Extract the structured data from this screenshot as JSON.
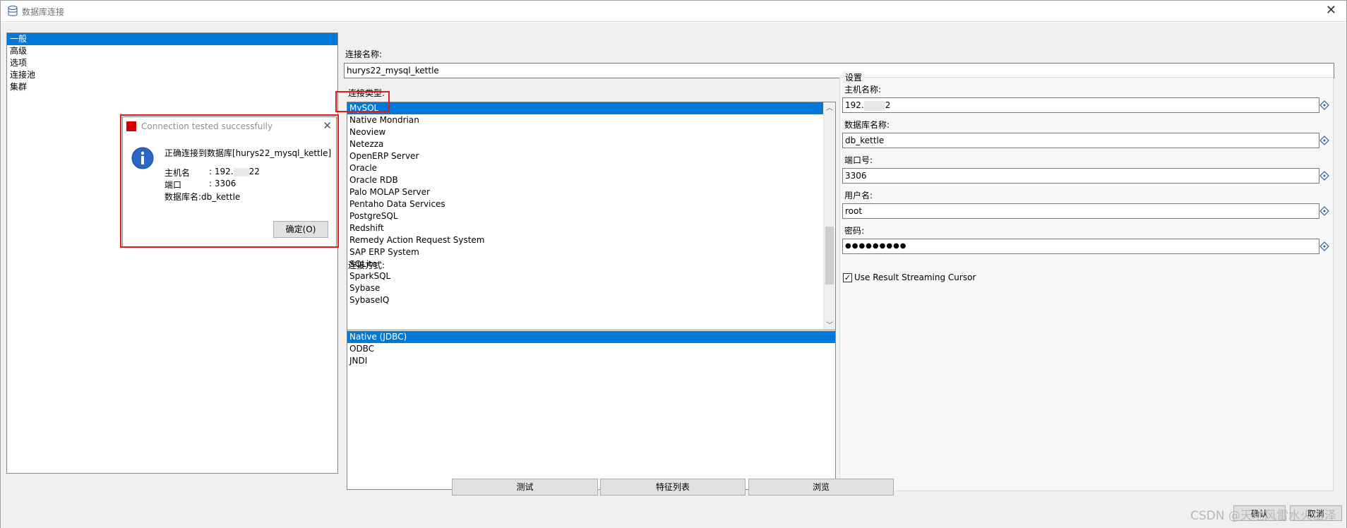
{
  "window": {
    "title": "数据库连接",
    "close_glyph": "✕"
  },
  "nav": {
    "items": [
      {
        "label": "一般",
        "selected": true
      },
      {
        "label": "高级",
        "selected": false
      },
      {
        "label": "选项",
        "selected": false
      },
      {
        "label": "连接池",
        "selected": false
      },
      {
        "label": "集群",
        "selected": false
      }
    ]
  },
  "form": {
    "connection_name_label": "连接名称:",
    "connection_name_value": "hurys22_mysql_kettle",
    "connection_type_label": "连接类型:",
    "connection_types": [
      "MySQL",
      "Native Mondrian",
      "Neoview",
      "Netezza",
      "OpenERP Server",
      "Oracle",
      "Oracle RDB",
      "Palo MOLAP Server",
      "Pentaho Data Services",
      "PostgreSQL",
      "Redshift",
      "Remedy Action Request System",
      "SAP ERP System",
      "SQLite",
      "SparkSQL",
      "Sybase",
      "SybaseIQ"
    ],
    "connection_type_selected": "MySQL",
    "access_label": "连接方式:",
    "access_methods": [
      "Native (JDBC)",
      "ODBC",
      "JNDI"
    ],
    "access_selected": "Native (JDBC)"
  },
  "settings": {
    "group_title": "设置",
    "host_label": "主机名称:",
    "host_value_prefix": "192.",
    "host_value_suffix": "2",
    "db_label": "数据库名称:",
    "db_value": "db_kettle",
    "port_label": "端口号:",
    "port_value": "3306",
    "user_label": "用户名:",
    "user_value": "root",
    "password_label": "密码:",
    "password_value": "●●●●●●●●●",
    "streaming_label": "Use Result Streaming Cursor",
    "streaming_checked": true
  },
  "buttons": {
    "test": "测试",
    "features": "特征列表",
    "explore": "浏览",
    "ok": "确认",
    "cancel": "取消"
  },
  "dialog": {
    "title": "Connection tested successfully",
    "message": "正确连接到数据库[hurys22_mysql_kettle]",
    "host_key": "主机名",
    "host_sep": ": 192.",
    "host_suffix": "22",
    "port_key": "端口",
    "port_sep": ": 3306",
    "db_line": "数据库名:db_kettle",
    "ok_button": "确定(O)"
  },
  "watermark": "CSDN @天地风雷水火山泽",
  "colors": {
    "selection": "#0078d7",
    "highlight": "#e21b1b"
  }
}
